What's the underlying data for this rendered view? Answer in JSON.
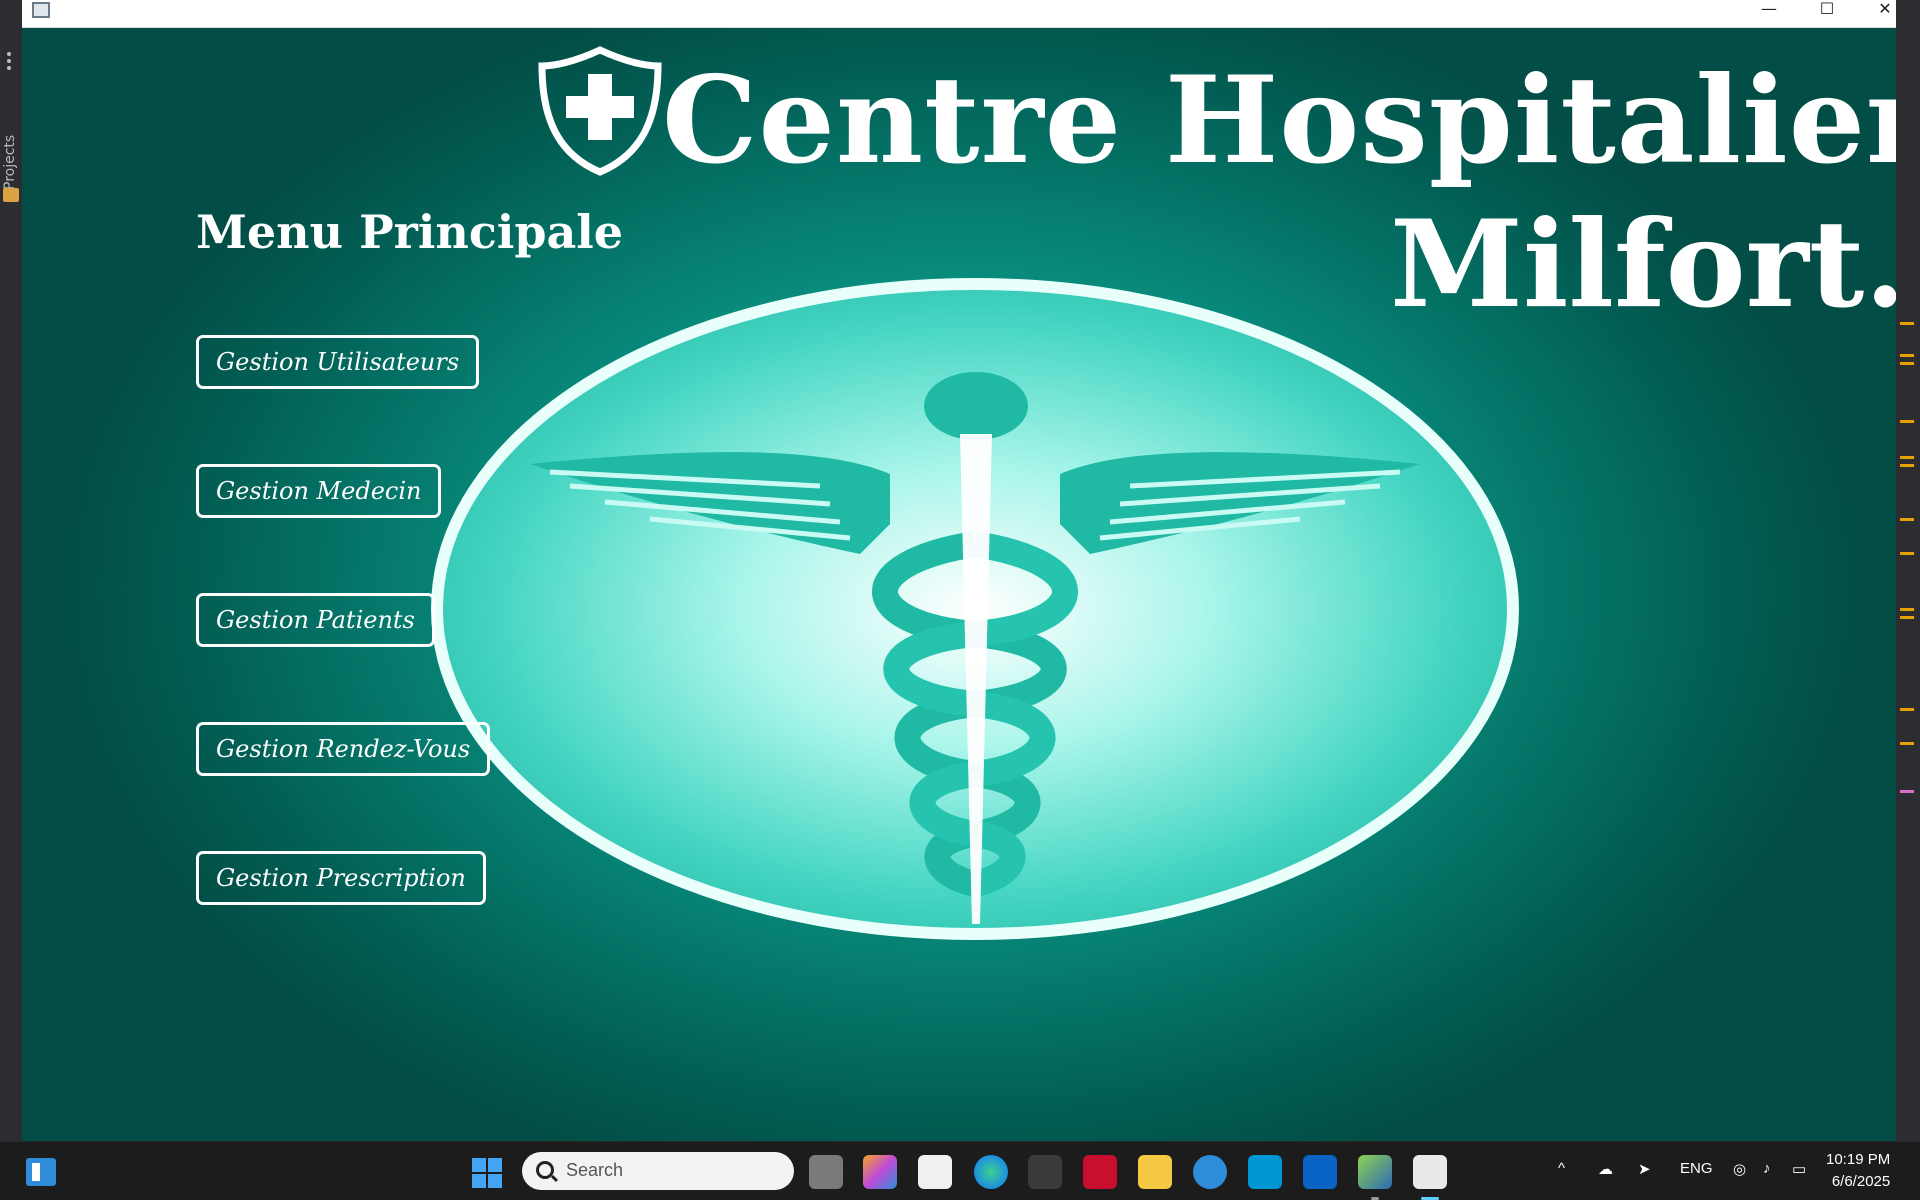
{
  "window": {
    "title_line1": "Centre Hospitalier",
    "title_line2": "Milfort.",
    "menu_heading": "Menu Principale",
    "controls": {
      "minimize": "—",
      "maximize": "☐",
      "close": "✕"
    }
  },
  "menu": {
    "buttons": [
      {
        "label": "Gestion Utilisateurs"
      },
      {
        "label": "Gestion Medecin"
      },
      {
        "label": "Gestion Patients"
      },
      {
        "label": "Gestion Rendez-Vous"
      },
      {
        "label": "Gestion Prescription"
      }
    ]
  },
  "ide": {
    "sidebar_label": "Projects"
  },
  "taskbar": {
    "search_placeholder": "Search",
    "language": "ENG",
    "time": "10:19 PM",
    "date": "6/6/2025",
    "apps": [
      "widgets",
      "start",
      "search",
      "task-view",
      "copilot",
      "store",
      "edge",
      "inkscape",
      "mcafee",
      "file-explorer",
      "get-help",
      "myhp",
      "outlook",
      "virtualbox",
      "java-app"
    ]
  },
  "colors": {
    "background_dark": "#024d45",
    "background_mid": "#067f71",
    "glow": "#2bc6b2",
    "text": "#ffffff",
    "taskbar": "#1c1c1c"
  }
}
